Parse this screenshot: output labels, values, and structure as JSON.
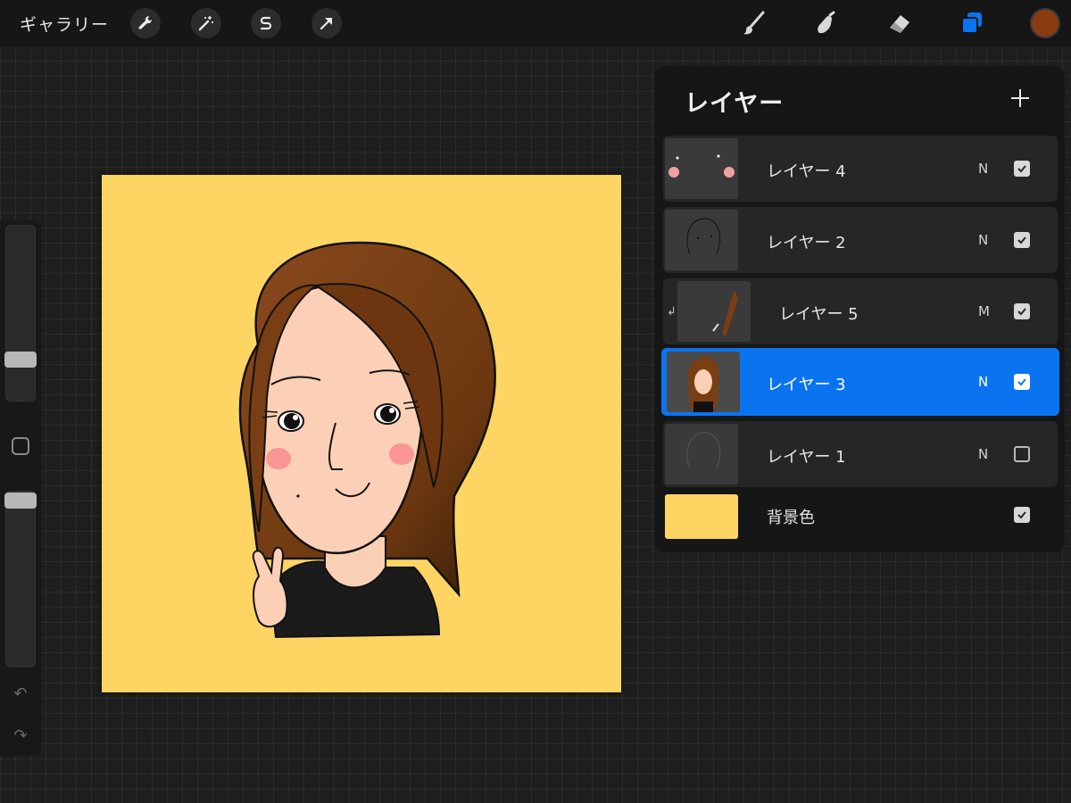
{
  "topbar": {
    "gallery_label": "ギャラリー",
    "left_tools": [
      "wrench-icon",
      "magic-wand-icon",
      "selection-s-icon",
      "move-arrow-icon"
    ],
    "right_tools": [
      "brush-icon",
      "smudge-icon",
      "eraser-icon",
      "layers-icon"
    ],
    "current_color": "#8a3b12",
    "active_tool_color": "#0a74f0"
  },
  "sidebar": {
    "brush_size_level": 0.27,
    "opacity_level": 0.06
  },
  "canvas": {
    "background_color": "#fed563"
  },
  "layers_panel": {
    "title": "レイヤー",
    "layers": [
      {
        "name": "レイヤー 4",
        "blend": "N",
        "visible": true,
        "selected": false,
        "clipped": false
      },
      {
        "name": "レイヤー 2",
        "blend": "N",
        "visible": true,
        "selected": false,
        "clipped": false
      },
      {
        "name": "レイヤー 5",
        "blend": "M",
        "visible": true,
        "selected": false,
        "clipped": true
      },
      {
        "name": "レイヤー 3",
        "blend": "N",
        "visible": true,
        "selected": true,
        "clipped": false
      },
      {
        "name": "レイヤー 1",
        "blend": "N",
        "visible": false,
        "selected": false,
        "clipped": false
      }
    ],
    "background_layer": {
      "name": "背景色",
      "visible": true,
      "color": "#fed563"
    }
  }
}
